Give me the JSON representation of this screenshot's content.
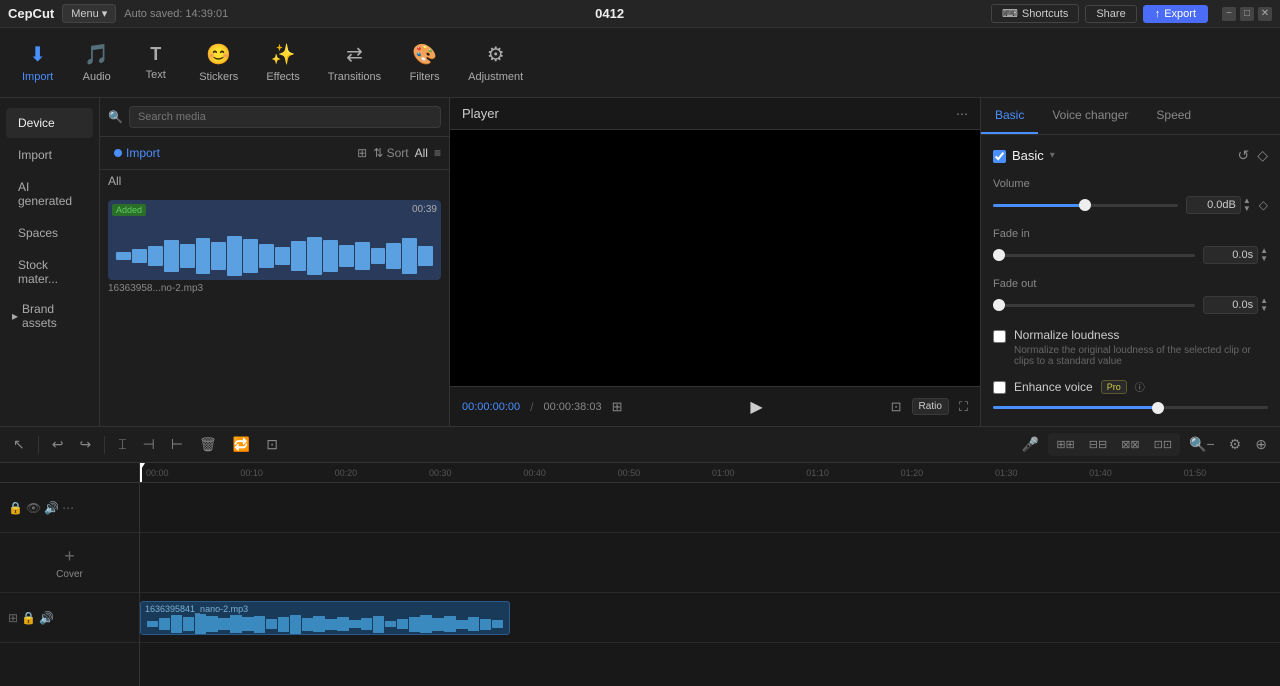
{
  "app": {
    "name": "CepCut",
    "menu_label": "Menu",
    "autosave": "Auto saved: 14:39:01",
    "center_code": "0412"
  },
  "top_bar": {
    "shortcuts_label": "Shortcuts",
    "share_label": "Share",
    "export_label": "Export"
  },
  "toolbar": {
    "items": [
      {
        "id": "import",
        "label": "Import",
        "icon": "⬇"
      },
      {
        "id": "audio",
        "label": "Audio",
        "icon": "🎵"
      },
      {
        "id": "text",
        "label": "Text",
        "icon": "T"
      },
      {
        "id": "stickers",
        "label": "Stickers",
        "icon": "😊"
      },
      {
        "id": "effects",
        "label": "Effects",
        "icon": "✨"
      },
      {
        "id": "transitions",
        "label": "Transitions",
        "icon": "⇄"
      },
      {
        "id": "filters",
        "label": "Filters",
        "icon": "🎨"
      },
      {
        "id": "adjustment",
        "label": "Adjustment",
        "icon": "⚙"
      }
    ]
  },
  "sidebar": {
    "items": [
      {
        "id": "device",
        "label": "Device"
      },
      {
        "id": "import",
        "label": "Import"
      },
      {
        "id": "ai_generated",
        "label": "AI generated"
      },
      {
        "id": "spaces",
        "label": "Spaces"
      },
      {
        "id": "stock_mater",
        "label": "Stock mater..."
      }
    ],
    "sections": [
      {
        "id": "brand_assets",
        "label": "Brand assets"
      }
    ]
  },
  "media_panel": {
    "search_placeholder": "Search media",
    "import_label": "Import",
    "all_label": "All",
    "sort_label": "Sort",
    "all_filter": "All",
    "items": [
      {
        "name": "16363958...no-2.mp3",
        "duration": "00:39",
        "badge": "Added"
      }
    ]
  },
  "player": {
    "title": "Player",
    "time_current": "00:00:00:00",
    "time_total": "00:00:38:03",
    "ratio_label": "Ratio"
  },
  "right_panel": {
    "tabs": [
      {
        "id": "basic",
        "label": "Basic",
        "active": true
      },
      {
        "id": "voice_changer",
        "label": "Voice changer"
      },
      {
        "id": "speed",
        "label": "Speed"
      }
    ],
    "basic": {
      "section_label": "Basic",
      "volume_label": "Volume",
      "volume_value": "0.0dB",
      "volume_pct": 50,
      "fade_in_label": "Fade in",
      "fade_in_value": "0.0s",
      "fade_out_label": "Fade out",
      "fade_out_value": "0.0s",
      "normalize_label": "Normalize loudness",
      "normalize_desc": "Normalize the original loudness of the selected clip or clips to a standard value",
      "enhance_label": "Enhance voice",
      "pro_badge": "Pro"
    }
  },
  "timeline": {
    "ruler_marks": [
      "00:00",
      "00:10",
      "00:20",
      "00:30",
      "00:40",
      "00:50",
      "01:00",
      "01:10",
      "01:20",
      "01:30",
      "01:40",
      "01:50"
    ],
    "cover_label": "Cover",
    "clip_name": "1636395841_nano-2.mp3"
  }
}
